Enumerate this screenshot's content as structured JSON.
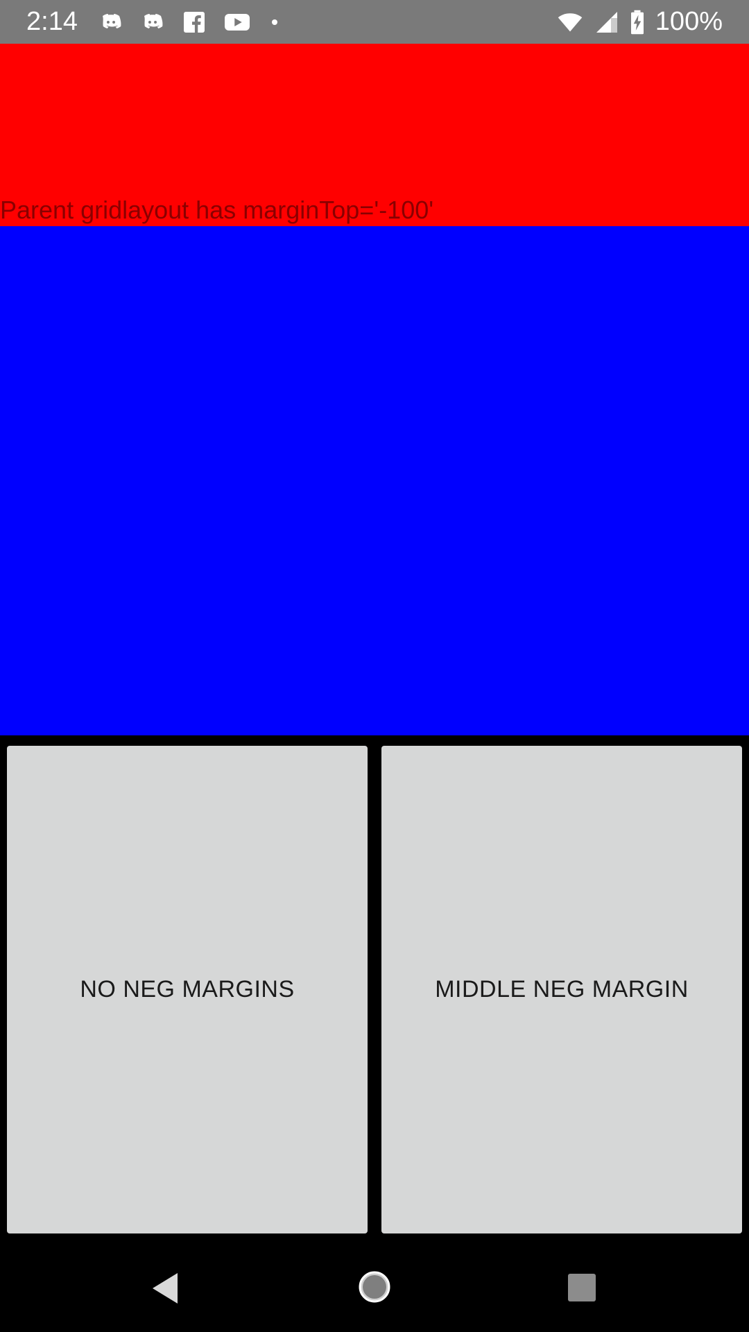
{
  "status_bar": {
    "time": "2:14",
    "battery_percent": "100%",
    "left_icons": [
      "discord-icon",
      "discord-icon",
      "facebook-icon",
      "youtube-icon",
      "notification-dot-icon"
    ],
    "right_icons": [
      "wifi-icon",
      "cellular-signal-icon",
      "battery-charging-icon"
    ]
  },
  "content": {
    "red_region_color": "#ff0000",
    "blue_region_color": "#0000ff",
    "red_label": "Parent gridlayout has marginTop='-100'"
  },
  "buttons": {
    "left_label": "NO NEG MARGINS",
    "right_label": "MIDDLE NEG MARGIN"
  },
  "nav_bar": {
    "icons": [
      "back-icon",
      "home-icon",
      "recents-icon"
    ]
  }
}
